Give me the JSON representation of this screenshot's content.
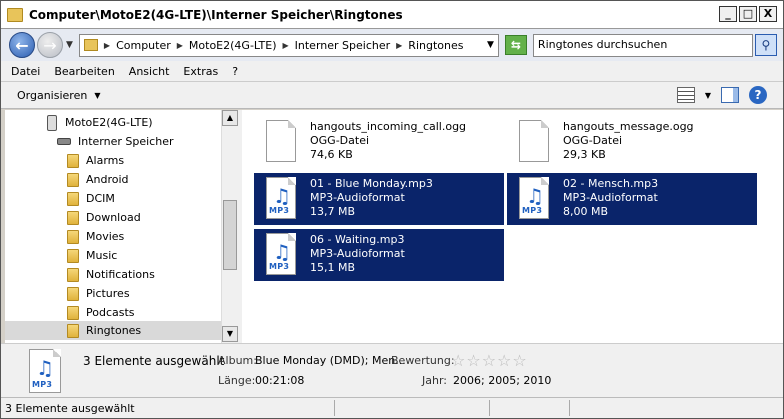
{
  "window": {
    "title": "Computer\\MotoE2(4G-LTE)\\Interner Speicher\\Ringtones",
    "min_label": "_",
    "max_label": "□",
    "close_label": "X"
  },
  "address": {
    "crumbs": [
      "Computer",
      "MotoE2(4G-LTE)",
      "Interner Speicher",
      "Ringtones"
    ],
    "search_placeholder": "Ringtones durchsuchen"
  },
  "menu": [
    "Datei",
    "Bearbeiten",
    "Ansicht",
    "Extras",
    "?"
  ],
  "toolbar": {
    "organize": "Organisieren"
  },
  "tree": {
    "device": "MotoE2(4G-LTE)",
    "storage": "Interner Speicher",
    "folders": [
      "Alarms",
      "Android",
      "DCIM",
      "Download",
      "Movies",
      "Music",
      "Notifications",
      "Pictures",
      "Podcasts",
      "Ringtones"
    ],
    "selected": "Ringtones"
  },
  "files": [
    {
      "name": "hangouts_incoming_call.ogg",
      "type": "OGG-Datei",
      "size": "74,6 KB",
      "icon": "ogg-file-icon",
      "selected": false
    },
    {
      "name": "hangouts_message.ogg",
      "type": "OGG-Datei",
      "size": "29,3 KB",
      "icon": "ogg-file-icon",
      "selected": false
    },
    {
      "name": "01 - Blue Monday.mp3",
      "type": "MP3-Audioformat",
      "size": "13,7 MB",
      "icon": "mp3-file-icon",
      "selected": true
    },
    {
      "name": "02 - Mensch.mp3",
      "type": "MP3-Audioformat",
      "size": "8,00 MB",
      "icon": "mp3-file-icon",
      "selected": true
    },
    {
      "name": "06 - Waiting.mp3",
      "type": "MP3-Audioformat",
      "size": "15,1 MB",
      "icon": "mp3-file-icon",
      "selected": true
    }
  ],
  "details": {
    "selection": "3 Elemente ausgewählt",
    "album_label": "Album:",
    "album_value": "Blue Monday (DMD); Men...",
    "rating_label": "Bewertung:",
    "rating": 0,
    "length_label": "Länge:",
    "length_value": "00:21:08",
    "year_label": "Jahr:",
    "year_value": "2006; 2005; 2010",
    "icon_tag": "MP3"
  },
  "status": {
    "text": "3 Elemente ausgewählt"
  },
  "colors": {
    "selection": "#0a246a",
    "folder": "#e8c45a"
  }
}
